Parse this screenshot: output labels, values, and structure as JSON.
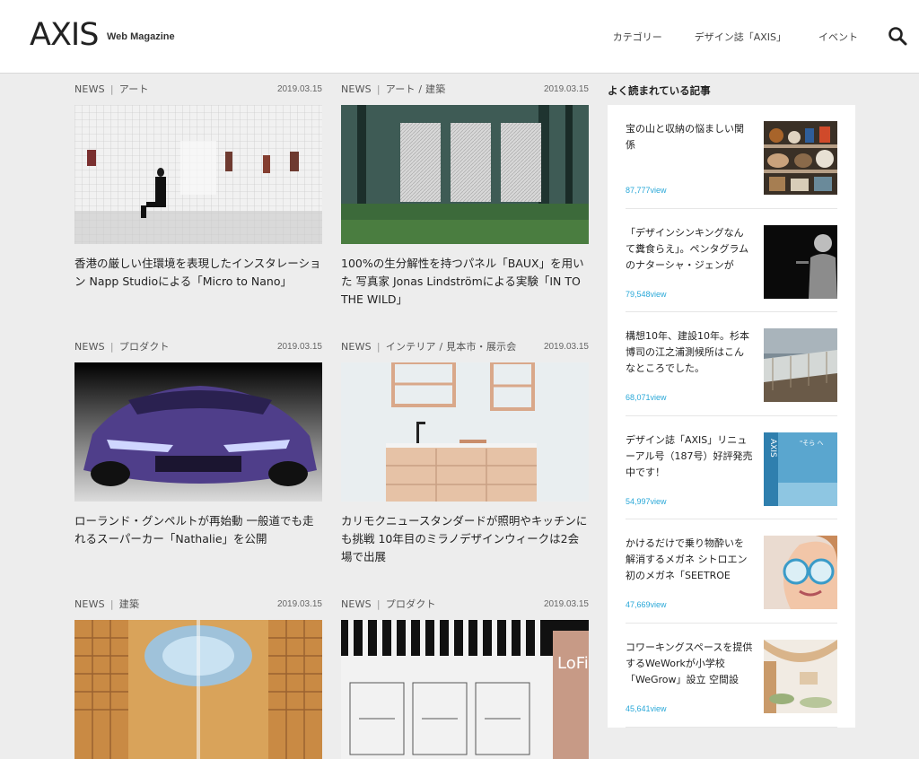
{
  "header": {
    "logo": "AXIS",
    "tagline": "Web Magazine",
    "nav": [
      "カテゴリー",
      "デザイン誌「AXIS」",
      "イベント"
    ]
  },
  "articles": [
    {
      "label": "NEWS",
      "category": "アート",
      "date": "2019.03.15",
      "title": "香港の厳しい住環境を表現したインスタレーション Napp Studioによる「Micro to Nano」"
    },
    {
      "label": "NEWS",
      "category": "アート / 建築",
      "date": "2019.03.15",
      "title": "100%の生分解性を持つパネル「BAUX」を用いた 写真家 Jonas Lindströmによる実験「IN TO THE WILD」"
    },
    {
      "label": "NEWS",
      "category": "プロダクト",
      "date": "2019.03.15",
      "title": "ローランド・グンペルトが再始動 一般道でも走れるスーパーカー「Nathalie」を公開"
    },
    {
      "label": "NEWS",
      "category": "インテリア / 見本市・展示会",
      "date": "2019.03.15",
      "title": "カリモクニュースタンダードが照明やキッチンにも挑戦 10年目のミラノデザインウィークは2会場で出展"
    },
    {
      "label": "NEWS",
      "category": "建築",
      "date": "2019.03.15",
      "title": ""
    },
    {
      "label": "NEWS",
      "category": "プロダクト",
      "date": "2019.03.15",
      "title": ""
    }
  ],
  "ranking": {
    "heading": "よく読まれている記事",
    "items": [
      {
        "title": "宝の山と収納の悩ましい関係",
        "views": "87,777view"
      },
      {
        "title": "「デザインシンキングなんて糞食らえ」。ペンタグラムのナターシャ・ジェンが",
        "views": "79,548view"
      },
      {
        "title": "構想10年、建設10年。杉本博司の江之浦測候所はこんなところでした。",
        "views": "68,071view"
      },
      {
        "title": "デザイン誌「AXIS」リニューアル号（187号）好評発売中です！",
        "views": "54,997view"
      },
      {
        "title": "かけるだけで乗り物酔いを解消するメガネ シトロエン初のメガネ「SEETROE",
        "views": "47,669view"
      },
      {
        "title": "コワーキングスペースを提供するWeWorkが小学校「WeGrow」設立 空間設",
        "views": "45,641view"
      }
    ]
  },
  "thumb_text": {
    "magazine_spine": "AXIS",
    "magazine_caption": "\"そら へ",
    "lofty_sign": "LoFi"
  }
}
